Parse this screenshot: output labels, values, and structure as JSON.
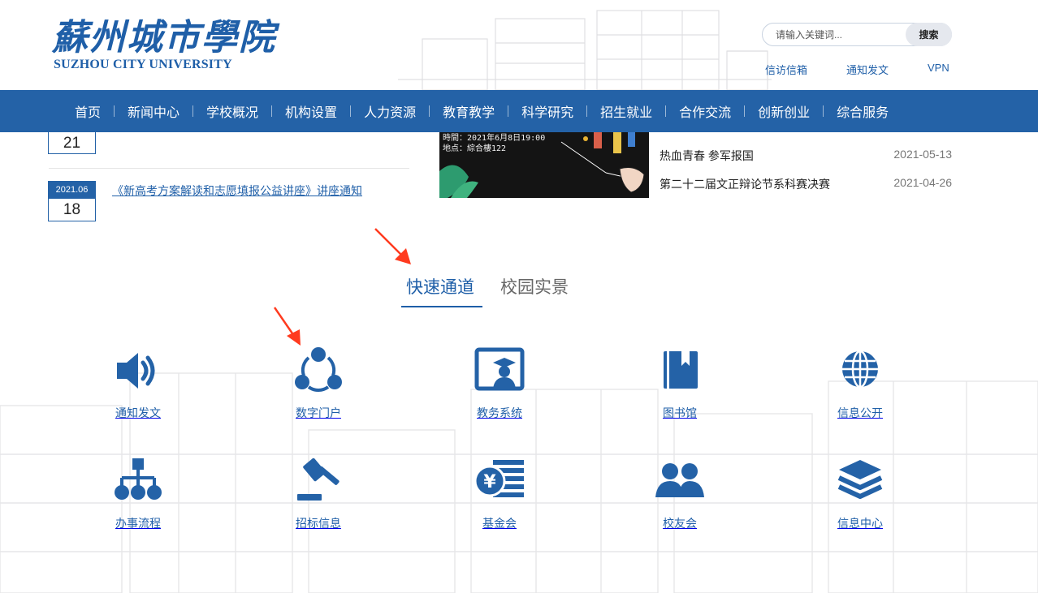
{
  "header": {
    "logo_cn": "蘇州城市學院",
    "logo_en": "SUZHOU CITY UNIVERSITY",
    "search_placeholder": "请输入关键词...",
    "search_button": "搜索",
    "top_links": [
      "信访信箱",
      "通知发文",
      "VPN"
    ]
  },
  "nav": {
    "items": [
      "首页",
      "新闻中心",
      "学校概况",
      "机构设置",
      "人力资源",
      "教育教学",
      "科学研究",
      "招生就业",
      "合作交流",
      "创新创业",
      "综合服务"
    ]
  },
  "news": {
    "items": [
      {
        "month": "",
        "day": "21",
        "title": ""
      },
      {
        "month": "2021.06",
        "day": "18",
        "title": "《新高考方案解读和志愿填报公益讲座》讲座通知"
      }
    ],
    "image_lines": [
      "時間：2021年6月8日19:00",
      "地点：綜合樓122"
    ],
    "right_items": [
      {
        "title": "热血青春 参军报国",
        "date": "2021-05-13"
      },
      {
        "title": "第二十二届文正辩论节系科赛决赛",
        "date": "2021-04-26"
      }
    ]
  },
  "tabs": [
    "快速通道",
    "校园实景"
  ],
  "quick_links": [
    {
      "label": "通知发文",
      "icon": "speaker-icon"
    },
    {
      "label": "数字门户",
      "icon": "share-network-icon"
    },
    {
      "label": "教务系统",
      "icon": "graduate-icon"
    },
    {
      "label": "图书馆",
      "icon": "book-icon"
    },
    {
      "label": "信息公开",
      "icon": "globe-icon"
    },
    {
      "label": "办事流程",
      "icon": "sitemap-icon"
    },
    {
      "label": "招标信息",
      "icon": "gavel-icon"
    },
    {
      "label": "基金会",
      "icon": "money-icon"
    },
    {
      "label": "校友会",
      "icon": "users-icon"
    },
    {
      "label": "信息中心",
      "icon": "layers-icon"
    }
  ],
  "colors": {
    "primary": "#2462a7",
    "link": "#1f5fa8",
    "annotation": "#ff3b1f"
  }
}
